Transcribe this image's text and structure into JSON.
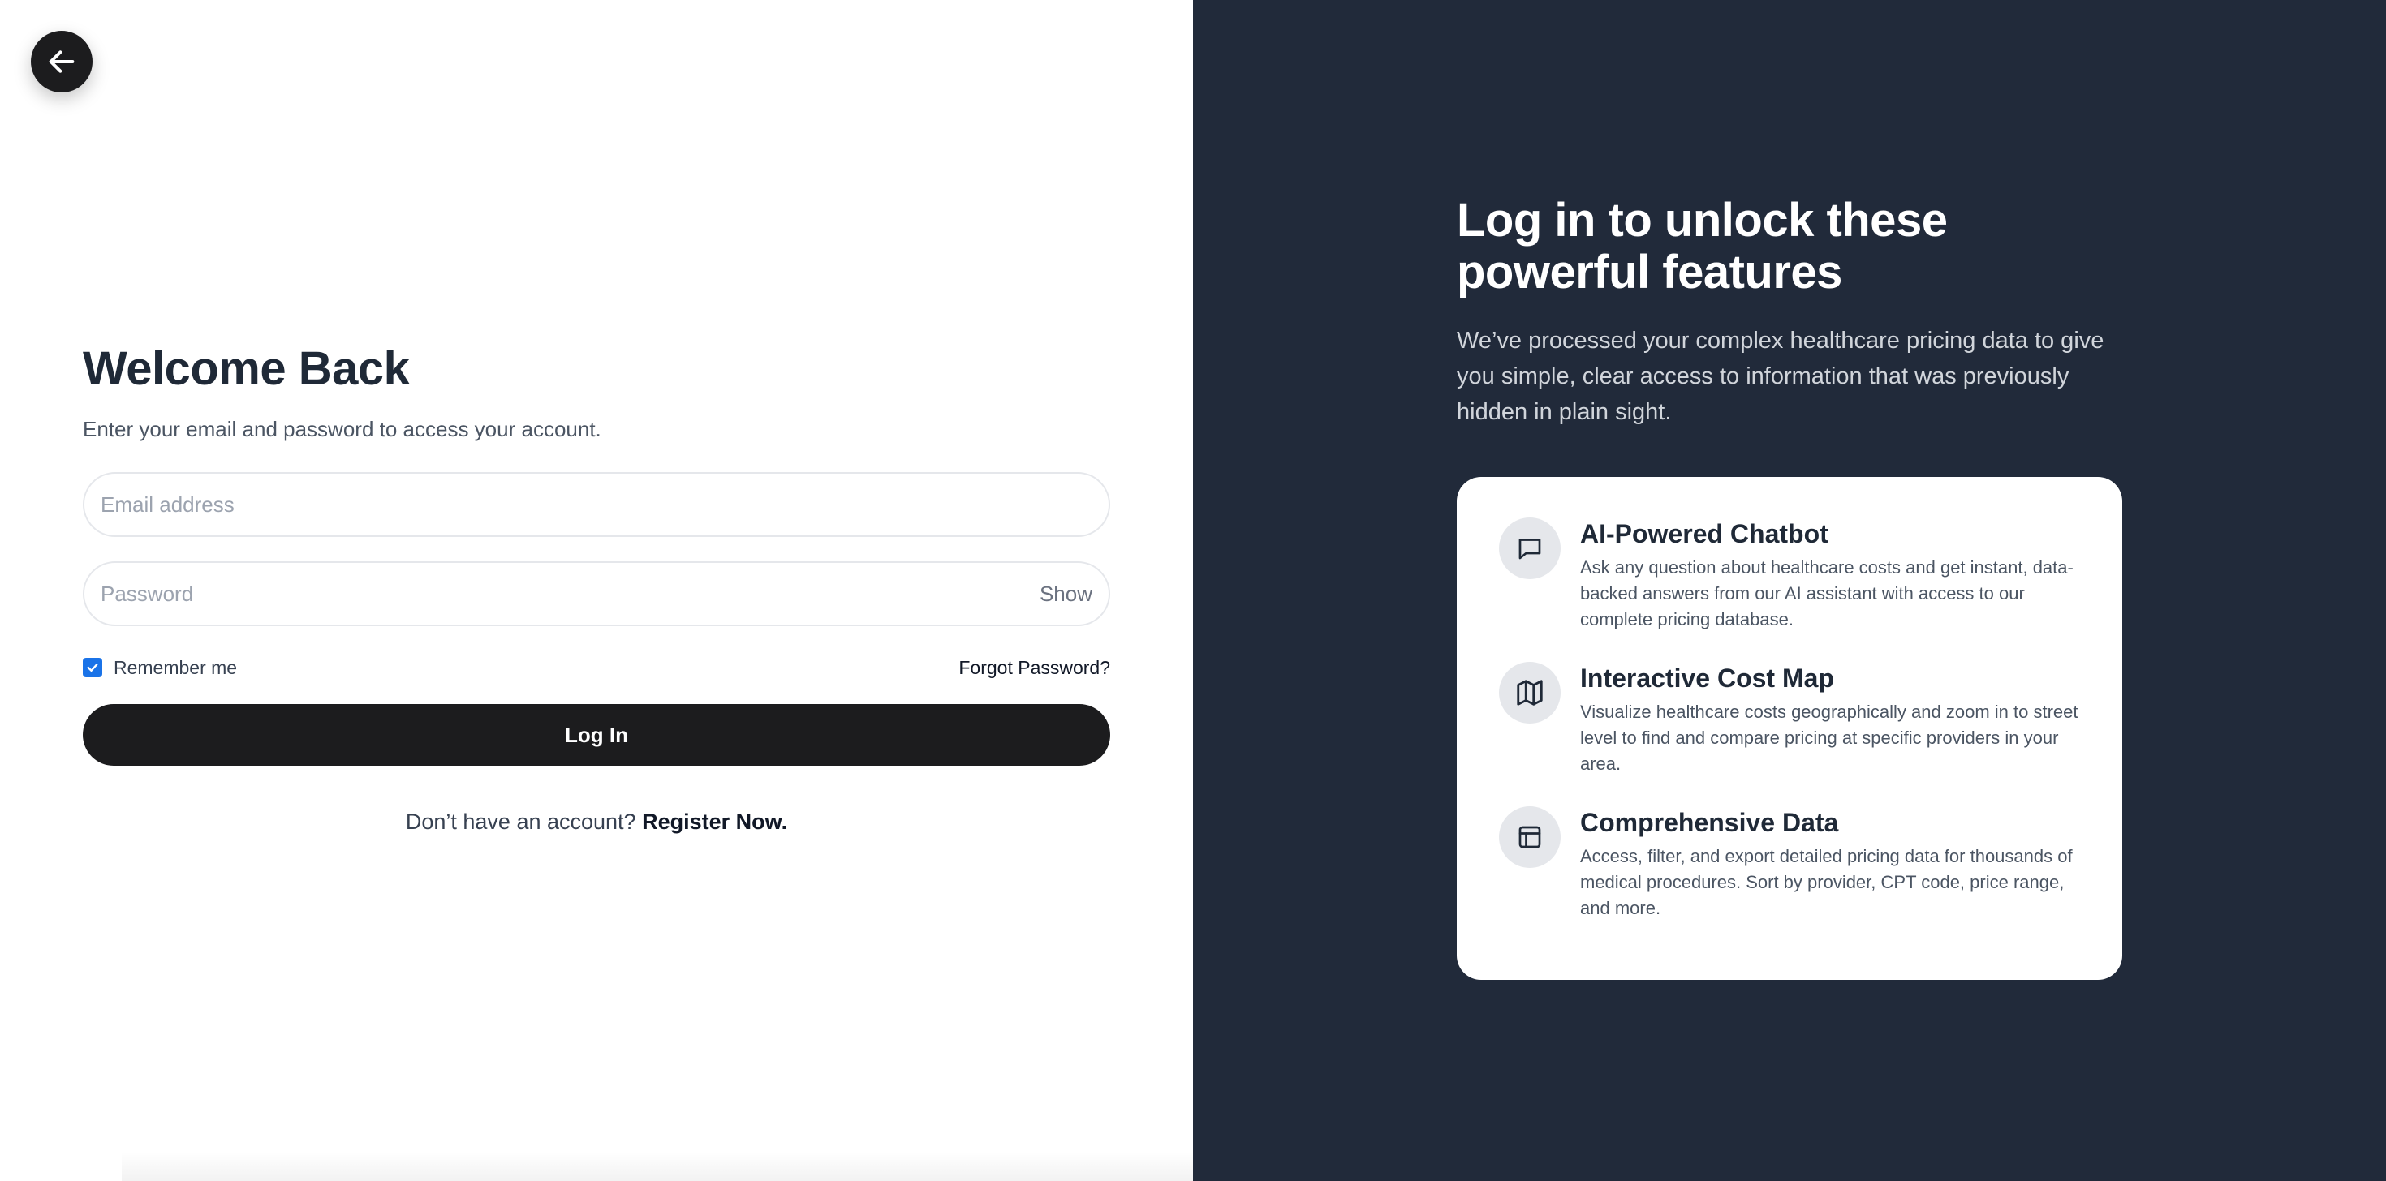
{
  "login": {
    "title": "Welcome Back",
    "subtitle": "Enter your email and password to access your account.",
    "email_placeholder": "Email address",
    "password_placeholder": "Password",
    "show_label": "Show",
    "remember_label": "Remember me",
    "remember_checked": true,
    "forgot_label": "Forgot Password?",
    "login_label": "Log In",
    "register_prompt": "Don’t have an account?",
    "register_link": "Register Now."
  },
  "promo": {
    "title": "Log in to unlock these powerful features",
    "description": "We’ve processed your complex healthcare pricing data to give you simple, clear access to information that was previously hidden in plain sight.",
    "features": [
      {
        "icon": "chat-bubble-icon",
        "title": "AI-Powered Chatbot",
        "description": "Ask any question about healthcare costs and get instant, data-backed answers from our AI assistant with access to our complete pricing database."
      },
      {
        "icon": "map-icon",
        "title": "Interactive Cost Map",
        "description": "Visualize healthcare costs geographically and zoom in to street level to find and compare pricing at specific providers in your area."
      },
      {
        "icon": "table-icon",
        "title": "Comprehensive Data",
        "description": "Access, filter, and export detailed pricing data for thousands of medical procedures. Sort by provider, CPT code, price range, and more."
      }
    ]
  },
  "colors": {
    "dark_panel": "#212a3a",
    "button": "#1c1c1e",
    "checkbox": "#1a73e8"
  },
  "icons": {
    "back": "arrow-left-icon",
    "check": "checkmark-icon"
  }
}
